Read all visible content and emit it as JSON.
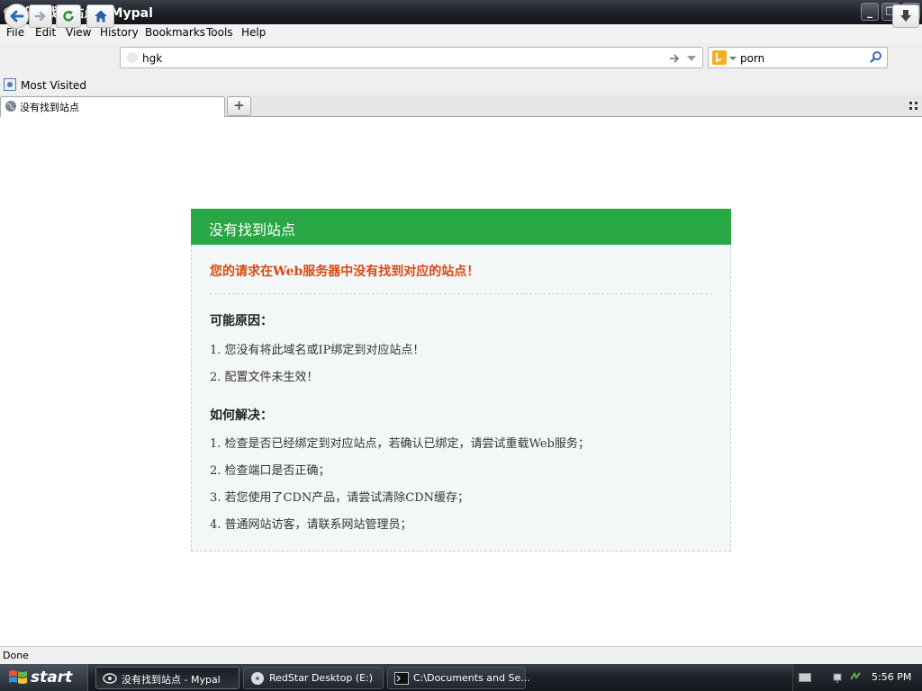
{
  "window": {
    "title": "没有找到站点 - Mypal",
    "minimize": "_",
    "maximize": "❐",
    "close": "✕"
  },
  "menu": [
    "File",
    "Edit",
    "View",
    "History",
    "Bookmarks",
    "Tools",
    "Help"
  ],
  "toolbar": {
    "url_value": "hgk",
    "search_value": "porn"
  },
  "bookmarks": {
    "most_visited": "Most Visited"
  },
  "tabs": [
    {
      "label": "没有找到站点"
    }
  ],
  "new_tab": "+",
  "page": {
    "header": "没有找到站点",
    "message": "您的请求在Web服务器中没有找到对应的站点！",
    "reasons_heading": "可能原因：",
    "reasons": [
      "1. 您没有将此域名或IP绑定到对应站点！",
      "2. 配置文件未生效！"
    ],
    "solutions_heading": "如何解决：",
    "solutions": [
      "1. 检查是否已经绑定到对应站点，若确认已绑定，请尝试重载Web服务；",
      "2. 检查端口是否正确；",
      "3. 若您使用了CDN产品，请尝试清除CDN缓存；",
      "4. 普通网站访客，请联系网站管理员；"
    ]
  },
  "status": "Done",
  "taskbar": {
    "start": "start",
    "tasks": [
      {
        "label": "没有找到站点 - Mypal"
      },
      {
        "label": "RedStar Desktop (E:)"
      },
      {
        "label": "C:\\Documents and Se..."
      }
    ],
    "clock": "5:56 PM"
  },
  "colors": {
    "header_green": "#28a745",
    "message_orange": "#d84a12",
    "panel_bg": "#f4f7f8"
  }
}
